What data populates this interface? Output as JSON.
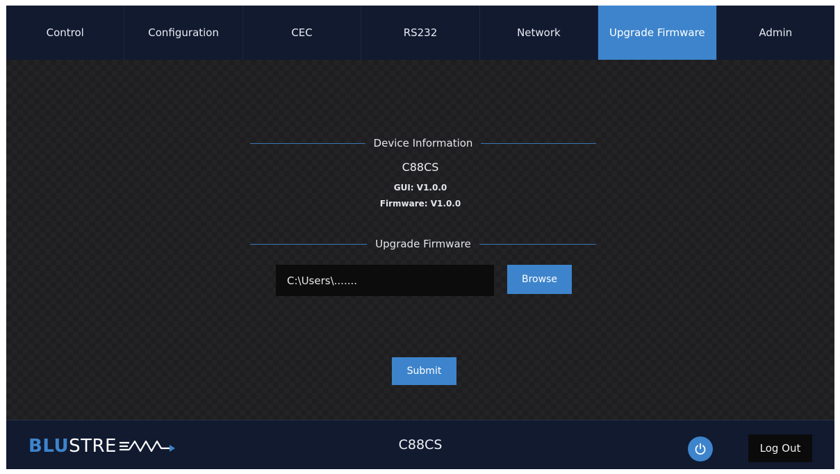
{
  "nav": {
    "tabs": [
      {
        "label": "Control"
      },
      {
        "label": "Configuration"
      },
      {
        "label": "CEC"
      },
      {
        "label": "RS232"
      },
      {
        "label": "Network"
      },
      {
        "label": "Upgrade Firmware"
      },
      {
        "label": "Admin"
      }
    ],
    "active_tab": "Upgrade Firmware"
  },
  "device_info": {
    "heading": "Device Information",
    "model": "C88CS",
    "gui_version": "GUI: V1.0.0",
    "firmware_version": "Firmware: V1.0.0"
  },
  "upgrade": {
    "heading": "Upgrade Firmware",
    "file_path_value": "C:\\Users\\.......",
    "browse_label": "Browse",
    "submit_label": "Submit"
  },
  "footer": {
    "logo_text_bold": "BLU",
    "logo_text_rest": "STRE",
    "model": "C88CS",
    "power_icon": "power-icon",
    "logout_label": "Log Out"
  },
  "colors": {
    "accent": "#3d84cc",
    "nav_bg": "#111a2f",
    "content_bg": "#1e1e20"
  }
}
